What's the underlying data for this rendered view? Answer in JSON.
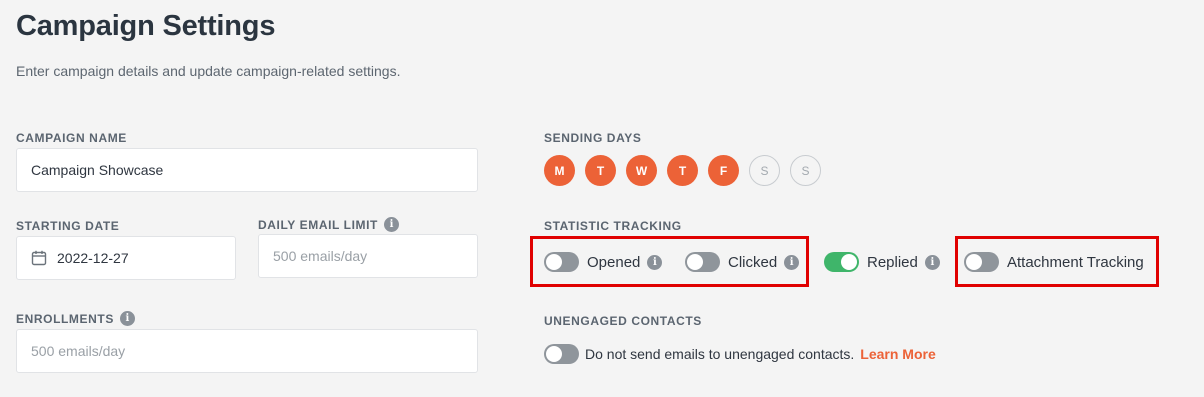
{
  "header": {
    "title": "Campaign Settings",
    "subtitle": "Enter campaign details and update campaign-related settings."
  },
  "campaign_name": {
    "label": "CAMPAIGN NAME",
    "value": "Campaign Showcase"
  },
  "starting_date": {
    "label": "STARTING DATE",
    "value": "2022-12-27",
    "icon": "calendar-icon"
  },
  "daily_email_limit": {
    "label": "DAILY EMAIL LIMIT",
    "placeholder": "500 emails/day",
    "icon": "info-icon"
  },
  "enrollments": {
    "label": "ENROLLMENTS",
    "placeholder": "500 emails/day",
    "icon": "info-icon"
  },
  "sending_days": {
    "label": "SENDING DAYS",
    "days": [
      {
        "letter": "M",
        "active": true
      },
      {
        "letter": "T",
        "active": true
      },
      {
        "letter": "W",
        "active": true
      },
      {
        "letter": "T",
        "active": true
      },
      {
        "letter": "F",
        "active": true
      },
      {
        "letter": "S",
        "active": false
      },
      {
        "letter": "S",
        "active": false
      }
    ]
  },
  "statistic_tracking": {
    "label": "STATISTIC TRACKING",
    "items": [
      {
        "label": "Opened",
        "enabled": false,
        "info": true
      },
      {
        "label": "Clicked",
        "enabled": false,
        "info": true
      },
      {
        "label": "Replied",
        "enabled": true,
        "info": true
      },
      {
        "label": "Attachment Tracking",
        "enabled": false,
        "info": false
      }
    ]
  },
  "unengaged_contacts": {
    "label": "UNENGAGED CONTACTS",
    "enabled": false,
    "text": "Do not send emails to unengaged contacts.",
    "link": "Learn More"
  },
  "info_glyph": "i",
  "colors": {
    "accent": "#ec6237",
    "toggle_on": "#3fb56a",
    "toggle_off": "#8f959b",
    "highlight": "#e00000",
    "background": "#f4f4f4"
  }
}
